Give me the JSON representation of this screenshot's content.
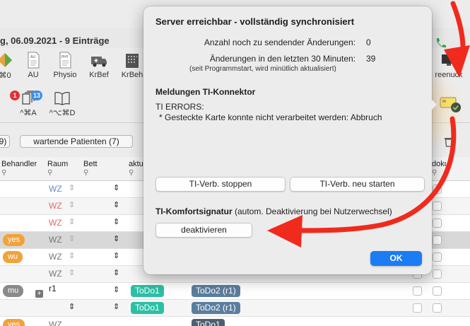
{
  "app": {
    "title": "g, 06.09.2021 - 9 Einträge",
    "toolbar": [
      {
        "label": "⌘0"
      },
      {
        "label": "AU"
      },
      {
        "label": "Physio"
      },
      {
        "label": "KrBef"
      },
      {
        "label": "KrBeh"
      }
    ],
    "toolbar_right_label": "reenuck",
    "toolbar2": {
      "item1_label": "^⌘A",
      "item1_badge_red": "1",
      "item1_badge_blue": "13",
      "item2_label": "^⌥⌘D"
    },
    "filters": {
      "prev_pill": "9)",
      "waiting": "wartende Patienten (7)"
    },
    "columns": {
      "behandler": "Behandler",
      "raum": "Raum",
      "bett": "Bett",
      "aktu": "aktu",
      "doku": "doku"
    },
    "rows": [
      {
        "raum": "WZ",
        "raum_color": "#6f86c7"
      },
      {
        "raum": "WZ",
        "raum_color": "#e06a6a"
      },
      {
        "raum": "WZ",
        "raum_color": "#e06a6a"
      },
      {
        "tag": "yes",
        "raum": "WZ",
        "raum_color": "#777777"
      },
      {
        "tag": "wu",
        "raum": "WZ",
        "raum_color": "#777777"
      },
      {
        "raum": "WZ",
        "raum_color": "#777777"
      },
      {
        "tag": "mu",
        "raum": "r1",
        "raum_color": "#222222",
        "todo1": "ToDo1",
        "todo2": "ToDo2 (r1)"
      },
      {
        "todo1": "ToDo1",
        "todo2": "ToDo2 (r1)"
      },
      {
        "tag": "yes",
        "raum": "WZ",
        "raum_color": "#777777",
        "todo2": "ToDo1"
      }
    ]
  },
  "popover": {
    "title": "Server erreichbar - vollständig synchronisiert",
    "pending_label": "Anzahl noch zu sendender Änderungen:",
    "pending_value": "0",
    "recent_label": "Änderungen in den letzten 30 Minuten:",
    "recent_value": "39",
    "recent_note": "(seit Programmstart, wird minütlich aktualisiert)",
    "ti_heading": "Meldungen TI-Konnektor",
    "ti_errors_title": "TI ERRORS:",
    "ti_error_line": "* Gesteckte Karte konnte nicht verarbeitet werden:  Abbruch",
    "btn_stop": "TI-Verb. stoppen",
    "btn_restart": "TI-Verb. neu starten",
    "sig_heading": "TI-Komfortsignatur",
    "sig_sub": "(autom. Deaktivierung bei Nutzerwechsel)",
    "btn_deactivate": "deaktivieren",
    "btn_ok": "OK"
  },
  "colors": {
    "accent": "#1b7cf4",
    "annotation_arrow": "#f02a1c",
    "tag_orange": "#f2a23a",
    "tag_gray": "#8a8a8a",
    "chip_teal": "#2dbfa5",
    "chip_slate": "#5b7d9e"
  }
}
